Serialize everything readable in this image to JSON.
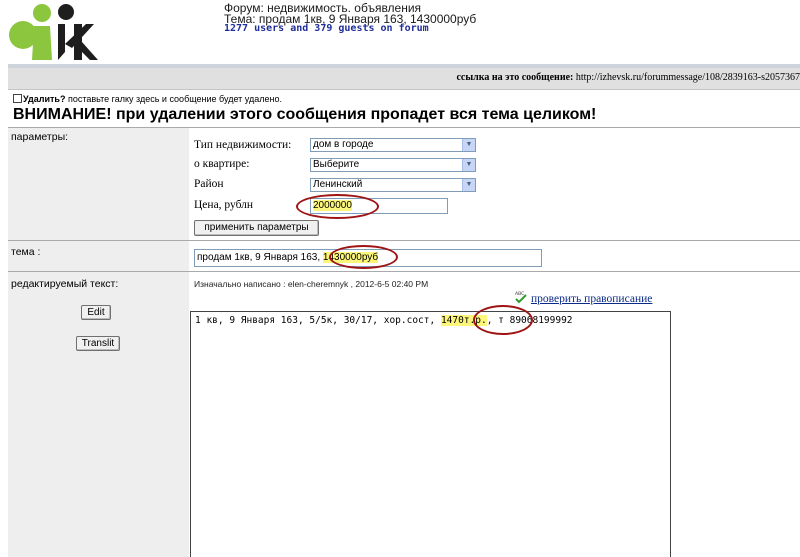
{
  "header": {
    "forum_line": "Форум: недвижимость. объявления",
    "topic_line": "Тема: продам 1кв, 9 Января 163, 1430000руб",
    "users_line": "1277 users and 379 guests on forum"
  },
  "link_bar": {
    "label": "ссылка на это сообщение:",
    "url": "http://izhevsk.ru/forummessage/108/2839163-s2057367"
  },
  "delete": {
    "label": "Удалить?",
    "hint": "поставьте галку здесь и сообщение будет удалено."
  },
  "warning": "ВНИМАНИЕ! при удалении этого сообщения пропадет вся тема целиком!",
  "params": {
    "section_label": "параметры:",
    "property_type_label": "Тип недвижимости:",
    "property_type_value": "дом в городе",
    "apartment_label": "о квартире:",
    "apartment_value": "Выберите",
    "district_label": "Район",
    "district_value": "Ленинский",
    "price_label": "Цена, рублн",
    "price_value": "2000000",
    "apply_button": "применить параметры"
  },
  "topic": {
    "section_label": "тема :",
    "value_prefix": "продам 1кв, 9 Января 163, ",
    "value_price": "1430000руб"
  },
  "editor": {
    "section_label": "редактируемый текст:",
    "original_note": "Изначально написано : elen-cheremnyk , 2012-6-5 02:40 PM",
    "spellcheck_link": "проверить правописание",
    "spellcheck_icon": "abc-check-icon",
    "edit_button": "Edit",
    "translit_button": "Translit",
    "text_prefix": "1 кв, 9 Января 163, 5/5к, 30/17, хор.сост, ",
    "text_price": "1470т.р.",
    "text_suffix": ", т 89068199992"
  },
  "colors": {
    "highlight": "#fcf77a",
    "annotation_ring": "#9e1414",
    "link": "#0a2b8a",
    "users_text": "#1f2d9a",
    "logo_green": "#8cc63e"
  }
}
